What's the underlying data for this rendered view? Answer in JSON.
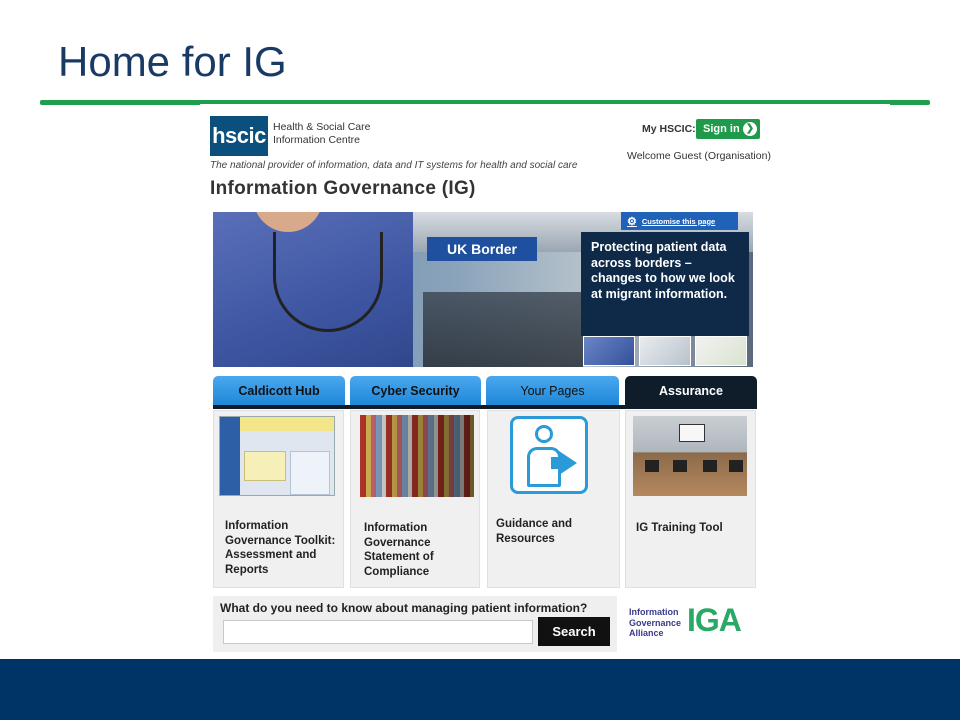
{
  "slide": {
    "title": "Home for IG"
  },
  "header": {
    "logo_mark": "hscic",
    "logo_name": "Health & Social Care Information Centre",
    "tagline": "The national provider of information, data and IT systems for health and social care",
    "my_hscic_label": "My HSCIC:",
    "sign_in_label": "Sign in",
    "welcome_text": "Welcome Guest (Organisation)",
    "page_heading": "Information Governance (IG)"
  },
  "hero": {
    "customise_label": "Customise this page",
    "sign_text": "UK Border",
    "caption": "Protecting patient data across borders – changes to how we look at migrant information."
  },
  "tabs": [
    {
      "label": "Caldicott Hub"
    },
    {
      "label": "Cyber Security"
    },
    {
      "label": "Your Pages"
    },
    {
      "label": "Assurance"
    }
  ],
  "cards": [
    {
      "label": "Information Governance Toolkit: Assessment and Reports"
    },
    {
      "label": "Information Governance Statement of Compliance"
    },
    {
      "label": "Guidance and Resources"
    },
    {
      "label": "IG Training Tool"
    }
  ],
  "search": {
    "question": "What do you need to know about managing patient information?",
    "input_value": "",
    "button_label": "Search"
  },
  "iga": {
    "text_line1": "Information",
    "text_line2": "Governance",
    "text_line3": "Alliance",
    "mark": "IGA"
  },
  "colors": {
    "title_blue": "#1a3a66",
    "rule_green": "#1e9e4f",
    "footer_navy": "#003366",
    "tab_blue": "#1e86d8",
    "tab_dark": "#0f1d2b",
    "signin_green": "#1f9a4a"
  }
}
